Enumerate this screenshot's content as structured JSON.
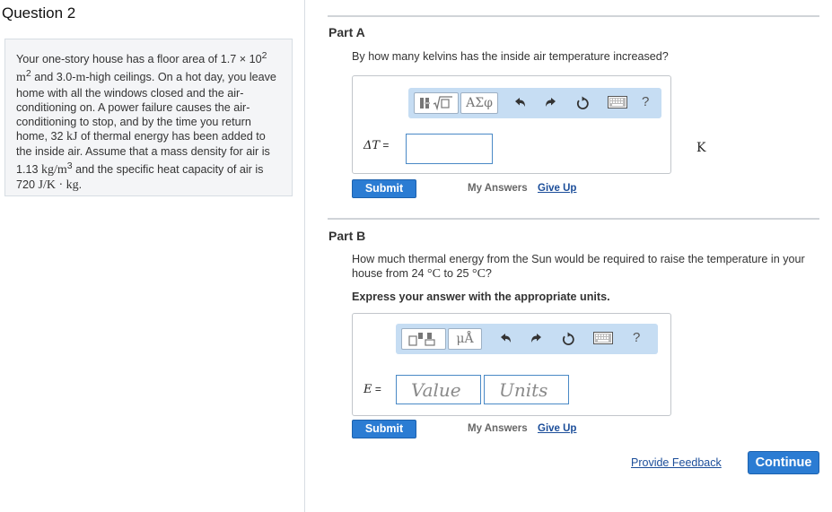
{
  "question": {
    "title": "Question 2",
    "problem": {
      "s1": "Your one-story house has a floor area of 1.7 × 10",
      "s1_exp": "2",
      "s2_m": "m",
      "s2_exp": "2",
      "s2": " and 3.0-",
      "s2_m2": "m",
      "s3": "-high ceilings. On a hot day, you leave home with all the windows closed and the air-conditioning on. A power failure causes the air-conditioning to stop, and by the time you return home, 32 ",
      "s3_m": "kJ",
      "s4": " of thermal energy has been added to the inside air. Assume that a mass density for air is 1.13 ",
      "s4_m": "kg/m",
      "s4_exp": "3",
      "s5": " and the specific heat capacity of air is 720 ",
      "s5_m": "J/K · kg",
      "s5_end": "."
    }
  },
  "partA": {
    "title": "Part A",
    "prompt": "By how many kelvins has the inside air temperature increased?",
    "toolbar": {
      "templates_icon": "fraction-sqrt-icon",
      "greek_label": "ΑΣφ",
      "undo_icon": "undo-icon",
      "redo_icon": "redo-icon",
      "reset_icon": "reset-icon",
      "keyboard_icon": "keyboard-icon",
      "help_label": "?"
    },
    "variable": "ΔT",
    "equals": " =",
    "input_value": "",
    "unit": "K",
    "submit_label": "Submit",
    "my_answers_label": "My Answers",
    "give_up_label": "Give Up"
  },
  "partB": {
    "title": "Part B",
    "prompt_a": "How much thermal energy from the Sun would be required to raise the temperature in your house from 24 ",
    "prompt_unit1": "°C",
    "prompt_b": " to 25 ",
    "prompt_unit2": "°C",
    "prompt_c": "?",
    "instruction": "Express your answer with the appropriate units.",
    "toolbar": {
      "templates_icon": "templates-icon",
      "units_label": "μÅ",
      "undo_icon": "undo-icon",
      "redo_icon": "redo-icon",
      "reset_icon": "reset-icon",
      "keyboard_icon": "keyboard-icon",
      "help_label": "?"
    },
    "variable": "E",
    "equals": " =",
    "value_placeholder": "Value",
    "units_placeholder": "Units",
    "submit_label": "Submit",
    "my_answers_label": "My Answers",
    "give_up_label": "Give Up"
  },
  "footer": {
    "feedback_label": "Provide Feedback",
    "continue_label": "Continue"
  },
  "colors": {
    "accent": "#2b7cd3",
    "link": "#1c4e9a",
    "toolbar_bg": "#c6ddf3"
  }
}
